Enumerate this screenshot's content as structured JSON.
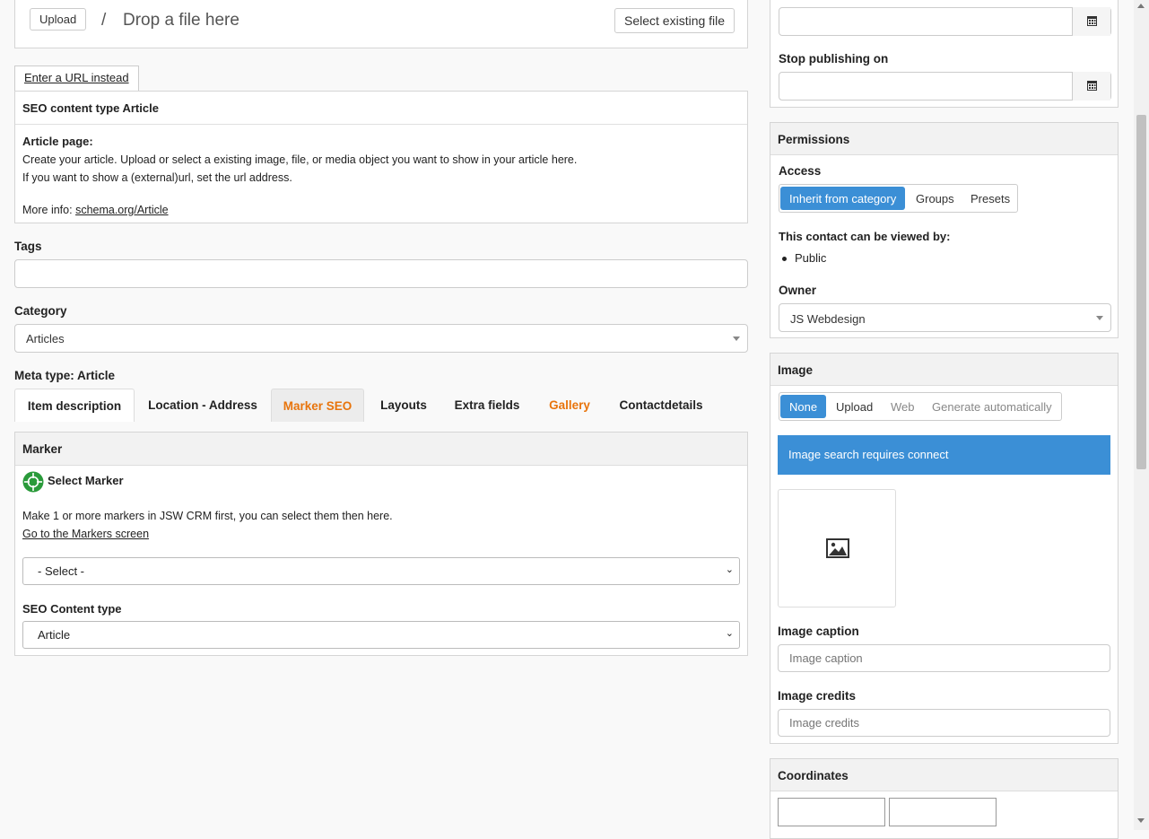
{
  "upload": {
    "upload_label": "Upload",
    "separator": "/",
    "drop_text": "Drop a file here",
    "select_existing_label": "Select existing file",
    "url_instead_label": "Enter a URL instead"
  },
  "seo_info": {
    "title": "SEO content type Article",
    "heading": "Article page:",
    "line1": "Create your article. Upload or select a existing image, file, or media object you want to show in your article here.",
    "line2": "If you want to show a (external)url, set the url address.",
    "more_info_prefix": "More info: ",
    "more_info_link": "schema.org/Article"
  },
  "tags": {
    "label": "Tags",
    "value": ""
  },
  "category": {
    "label": "Category",
    "value": "Articles"
  },
  "meta_type": {
    "label": "Meta type: Article"
  },
  "tabs": [
    {
      "label": "Item description"
    },
    {
      "label": "Location - Address"
    },
    {
      "label": "Marker SEO"
    },
    {
      "label": "Layouts"
    },
    {
      "label": "Extra fields"
    },
    {
      "label": "Gallery"
    },
    {
      "label": "Contactdetails"
    }
  ],
  "marker": {
    "panel_title": "Marker",
    "select_marker_label": "Select Marker",
    "help_text": "Make 1 or more markers in JSW CRM first, you can select them then here.",
    "link_text": "Go to the Markers screen",
    "select_value": "- Select -",
    "seo_content_type_label": "SEO Content type",
    "seo_content_type_value": "Article"
  },
  "publishing": {
    "stop_label": "Stop publishing on",
    "start_value": "",
    "stop_value": ""
  },
  "permissions": {
    "title": "Permissions",
    "access_label": "Access",
    "access_options": [
      "Inherit from category",
      "Groups",
      "Presets"
    ],
    "viewed_by_label": "This contact can be viewed by:",
    "viewed_by_items": [
      "Public"
    ],
    "owner_label": "Owner",
    "owner_value": "JS Webdesign"
  },
  "image": {
    "title": "Image",
    "options": [
      "None",
      "Upload",
      "Web",
      "Generate automatically"
    ],
    "notice": "Image search requires connect",
    "caption_label": "Image caption",
    "caption_placeholder": "Image caption",
    "credits_label": "Image credits",
    "credits_placeholder": "Image credits"
  },
  "coordinates": {
    "title": "Coordinates"
  },
  "colors": {
    "accent": "#3b8fd6",
    "orange_tab": "#e8740c"
  }
}
